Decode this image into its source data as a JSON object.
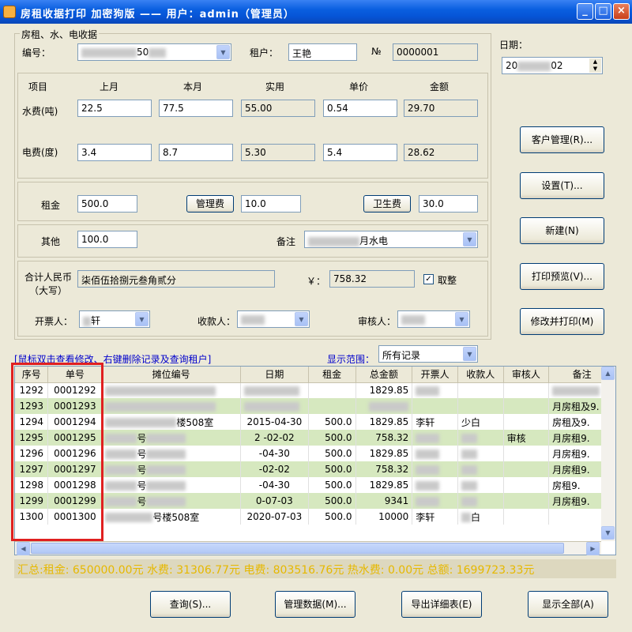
{
  "window": {
    "title": "房租收据打印       加密狗版  ——  用户：admin（管理员）",
    "min": "_",
    "max": "□",
    "close": "×"
  },
  "form": {
    "group_title": "房租、水、电收据",
    "code_label": "编号：",
    "code_value": "50",
    "tenant_label": "租户：",
    "tenant_value": "王艳",
    "no_label": "№",
    "no_value": "0000001",
    "headers": {
      "item": "项目",
      "last": "上月",
      "current": "本月",
      "actual": "实用",
      "price": "单价",
      "amount": "金额"
    },
    "water": {
      "label": "水费(吨)",
      "last": "22.5",
      "current": "77.5",
      "actual": "55.00",
      "price": "0.54",
      "amount": "29.70"
    },
    "electric": {
      "label": "电费(度)",
      "last": "3.4",
      "current": "8.7",
      "actual": "5.30",
      "price": "5.4",
      "amount": "28.62"
    },
    "rent_label": "租金",
    "rent_value": "500.0",
    "mgmt_button": "管理费",
    "mgmt_value": "10.0",
    "sanitation_button": "卫生费",
    "sanitation_value": "30.0",
    "other_label": "其他",
    "other_value": "100.0",
    "remark_label": "备注",
    "remark_value": "月水电",
    "total_label": "合计人民币（大写）",
    "total_upper": "柒佰伍拾捌元叁角贰分",
    "yen_label": "￥：",
    "total_value": "758.32",
    "round_label": "取整",
    "round_check": "✓",
    "issuer_label": "开票人：",
    "issuer_value": "轩",
    "payee_label": "收款人：",
    "auditor_label": "审核人："
  },
  "date": {
    "label": "日期：",
    "value_prefix": "20",
    "value_suffix": "02"
  },
  "side_buttons": [
    "客户管理(R)...",
    "设置(T)...",
    "新建(N)",
    "打印预览(V)...",
    "修改并打印(M)"
  ],
  "hint": "[鼠标双击查看修改、右键删除记录及查询租户]",
  "range_label": "显示范围：",
  "range_value": "所有记录",
  "table": {
    "columns": [
      "序号",
      "单号",
      "摊位编号",
      "日期",
      "租金",
      "总金额",
      "开票人",
      "收款人",
      "审核人",
      "备注"
    ],
    "rows": [
      {
        "seq": "1292",
        "no": "0001292",
        "stall": "",
        "date": "",
        "rent": "",
        "total": "1829.85",
        "issuer": "",
        "payee": "",
        "auditor": "",
        "remark": ""
      },
      {
        "seq": "1293",
        "no": "0001293",
        "stall": "",
        "date": "",
        "rent": "",
        "total": "",
        "issuer": "",
        "payee": "",
        "auditor": "",
        "remark": "月房租及9."
      },
      {
        "seq": "1294",
        "no": "0001294",
        "stall": "楼508室",
        "date": "2015-04-30",
        "rent": "500.0",
        "total": "1829.85",
        "issuer": "李轩",
        "payee": "少白",
        "auditor": "",
        "remark": "房租及9."
      },
      {
        "seq": "1295",
        "no": "0001295",
        "stall": "号",
        "date": "2 -02-02",
        "rent": "500.0",
        "total": "758.32",
        "issuer": "",
        "payee": "",
        "auditor": "审核",
        "remark": "月房租9."
      },
      {
        "seq": "1296",
        "no": "0001296",
        "stall": "号",
        "date": "-04-30",
        "rent": "500.0",
        "total": "1829.85",
        "issuer": "",
        "payee": "",
        "auditor": "",
        "remark": "月房租9."
      },
      {
        "seq": "1297",
        "no": "0001297",
        "stall": "号",
        "date": "-02-02",
        "rent": "500.0",
        "total": "758.32",
        "issuer": "",
        "payee": "",
        "auditor": "",
        "remark": "月房租9."
      },
      {
        "seq": "1298",
        "no": "0001298",
        "stall": "号",
        "date": "-04-30",
        "rent": "500.0",
        "total": "1829.85",
        "issuer": "",
        "payee": "",
        "auditor": "",
        "remark": "房租9."
      },
      {
        "seq": "1299",
        "no": "0001299",
        "stall": "号",
        "date": "0-07-03",
        "rent": "500.0",
        "total": "9341",
        "issuer": "",
        "payee": "",
        "auditor": "",
        "remark": "月房租9."
      },
      {
        "seq": "1300",
        "no": "0001300",
        "stall": "号楼508室",
        "date": "2020-07-03",
        "rent": "500.0",
        "total": "10000",
        "issuer": "李轩",
        "payee": "白",
        "auditor": "",
        "remark": ""
      }
    ]
  },
  "summary": "汇总:租金: 650000.00元  水费: 31306.77元  电费: 803516.76元  热水费: 0.00元  总额: 1699723.33元",
  "bottom_buttons": [
    "查询(S)...",
    "管理数据(M)...",
    "导出详细表(E)",
    "显示全部(A)"
  ]
}
